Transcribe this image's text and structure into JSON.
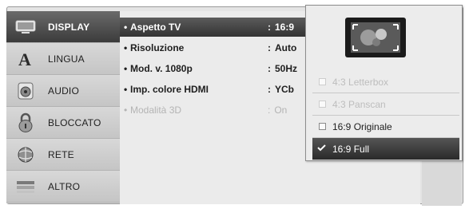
{
  "sidebar": {
    "items": [
      {
        "label": "DISPLAY",
        "icon": "display-icon",
        "selected": true
      },
      {
        "label": "LINGUA",
        "icon": "language-icon",
        "selected": false
      },
      {
        "label": "AUDIO",
        "icon": "audio-icon",
        "selected": false
      },
      {
        "label": "BLOCCATO",
        "icon": "lock-icon",
        "selected": false
      },
      {
        "label": "RETE",
        "icon": "network-icon",
        "selected": false
      },
      {
        "label": "ALTRO",
        "icon": "other-icon",
        "selected": false
      }
    ]
  },
  "settings": {
    "rows": [
      {
        "label": "Aspetto TV",
        "value": "16:9",
        "selected": true,
        "disabled": false
      },
      {
        "label": "Risoluzione",
        "value": "Auto",
        "selected": false,
        "disabled": false
      },
      {
        "label": "Mod. v. 1080p",
        "value": "50Hz",
        "selected": false,
        "disabled": false
      },
      {
        "label": "Imp. colore HDMI",
        "value": "YCb",
        "selected": false,
        "disabled": false
      },
      {
        "label": "Modalità 3D",
        "value": "On",
        "selected": false,
        "disabled": true
      }
    ],
    "bullet": "•",
    "colon": ":"
  },
  "popup": {
    "icon": "tv-aspect-icon",
    "options": [
      {
        "label": "4:3 Letterbox",
        "disabled": true,
        "selected": false
      },
      {
        "label": "4:3 Panscan",
        "disabled": true,
        "selected": false
      },
      {
        "label": "16:9 Originale",
        "disabled": false,
        "selected": false
      },
      {
        "label": "16:9 Full",
        "disabled": false,
        "selected": true
      }
    ]
  }
}
